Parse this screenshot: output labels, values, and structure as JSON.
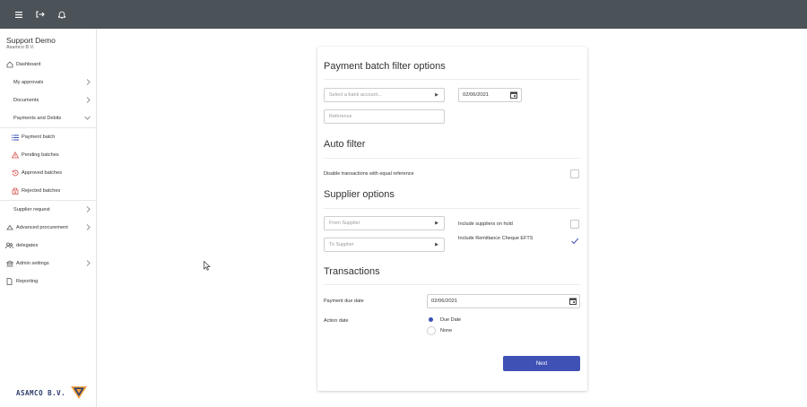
{
  "topbar": {
    "icons": [
      "menu-icon",
      "logout-icon",
      "bell-icon"
    ]
  },
  "sidebar": {
    "org_name": "Support Demo",
    "org_sub": "Asamco B.V.",
    "items": [
      {
        "label": "Dashboard",
        "icon": "home-icon"
      },
      {
        "label": "My approvals"
      },
      {
        "label": "Documents"
      },
      {
        "label": "Payments and Debits"
      },
      {
        "label": "Payment batch",
        "icon": "list-icon"
      },
      {
        "label": "Pending batches",
        "icon": "warning-icon"
      },
      {
        "label": "Approved batches",
        "icon": "history-icon"
      },
      {
        "label": "Rejected batches",
        "icon": "reject-icon"
      },
      {
        "label": "Supplier request"
      },
      {
        "label": "Advanced procurement",
        "icon": "cart-icon"
      },
      {
        "label": "delegates",
        "icon": "people-icon"
      },
      {
        "label": "Admin settings",
        "icon": "bank-icon"
      },
      {
        "label": "Reporting",
        "icon": "document-icon"
      }
    ],
    "logo_text": "ASAMCO B.V."
  },
  "form": {
    "filter_title": "Payment batch filter options",
    "bank_placeholder": "Select a bank account...",
    "filter_date": "02/06/2021",
    "reference_placeholder": "Reference",
    "auto_title": "Auto filter",
    "disable_label": "Disable transactions with equal reference",
    "supplier_title": "Supplier options",
    "from_placeholder": "From Supplier",
    "to_placeholder": "To Supplier",
    "include_hold_label": "Include suppliers on hold",
    "include_remit_label": "Include Remittance Cheque EFTS",
    "transactions_title": "Transactions",
    "due_label": "Payment due date",
    "due_date": "02/06/2021",
    "action_label": "Action date",
    "radio_due": "Due Date",
    "radio_none": "None",
    "next_label": "Next"
  },
  "colors": {
    "topbar": "#4b5258",
    "primary": "#3f51b5",
    "danger": "#d9534f"
  }
}
